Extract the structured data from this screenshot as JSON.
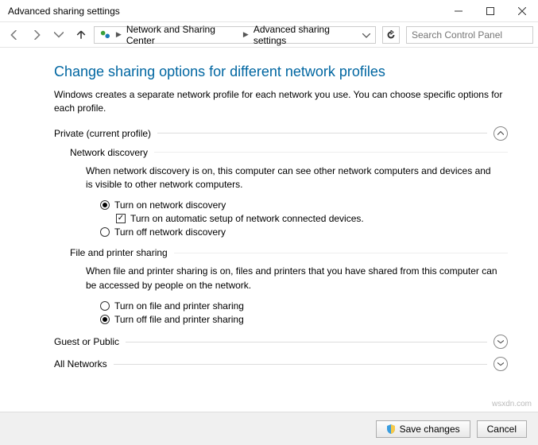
{
  "window": {
    "title": "Advanced sharing settings"
  },
  "nav": {
    "crumb1": "Network and Sharing Center",
    "crumb2": "Advanced sharing settings",
    "search_placeholder": "Search Control Panel"
  },
  "page": {
    "title": "Change sharing options for different network profiles",
    "desc": "Windows creates a separate network profile for each network you use. You can choose specific options for each profile."
  },
  "sections": {
    "private": {
      "label": "Private (current profile)"
    },
    "netdisc": {
      "label": "Network discovery",
      "desc": "When network discovery is on, this computer can see other network computers and devices and is visible to other network computers.",
      "opt_on": "Turn on network discovery",
      "opt_auto": "Turn on automatic setup of network connected devices.",
      "opt_off": "Turn off network discovery"
    },
    "fps": {
      "label": "File and printer sharing",
      "desc": "When file and printer sharing is on, files and printers that you have shared from this computer can be accessed by people on the network.",
      "opt_on": "Turn on file and printer sharing",
      "opt_off": "Turn off file and printer sharing"
    },
    "guest": {
      "label": "Guest or Public"
    },
    "all": {
      "label": "All Networks"
    }
  },
  "footer": {
    "save": "Save changes",
    "cancel": "Cancel"
  },
  "watermark": "wsxdn.com"
}
